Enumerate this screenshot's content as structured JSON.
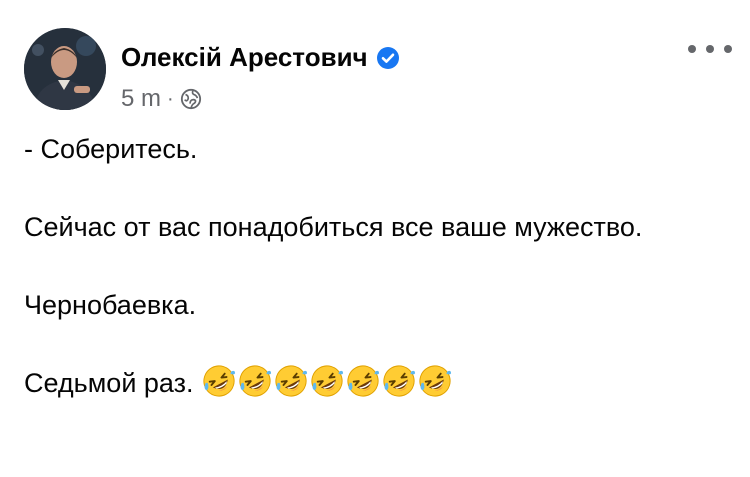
{
  "post": {
    "author_name": "Олексій Арестович",
    "time": "5 m",
    "separator": "·",
    "icons": {
      "avatar": "profile-photo",
      "verified": "verified-badge-icon",
      "audience": "globe-icon",
      "more": "more-options-icon"
    },
    "accent_color": "#1877f2",
    "paragraphs": [
      "- Соберитесь.",
      "Сейчас от вас понадобиться все ваше мужество.",
      "Чернобаевка.",
      "Седьмой раз."
    ],
    "trailing_emoji": {
      "name": "rolling-on-the-floor-laughing-emoji",
      "count": 7
    }
  }
}
